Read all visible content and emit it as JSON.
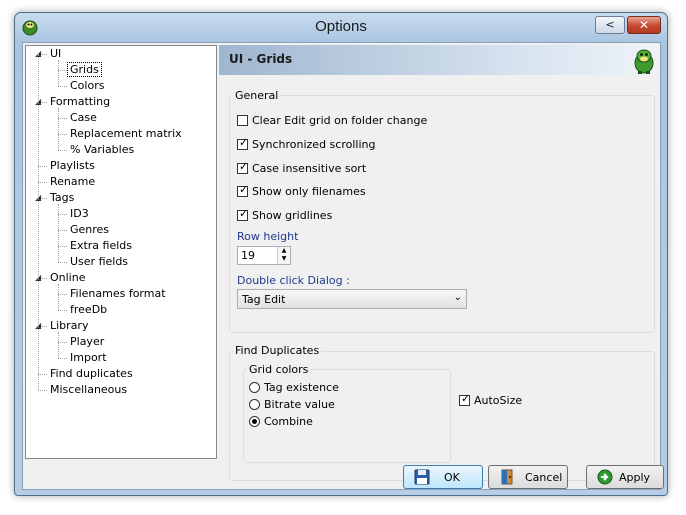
{
  "window": {
    "title": "Options",
    "minimize_glyph": "<",
    "close_glyph": "✕"
  },
  "tree": {
    "items": [
      {
        "label": "UI",
        "level": 0,
        "expanded": true
      },
      {
        "label": "Grids",
        "level": 1,
        "selected": true
      },
      {
        "label": "Colors",
        "level": 1
      },
      {
        "label": "Formatting",
        "level": 0,
        "expanded": true
      },
      {
        "label": "Case",
        "level": 1
      },
      {
        "label": "Replacement matrix",
        "level": 1
      },
      {
        "label": "% Variables",
        "level": 1
      },
      {
        "label": "Playlists",
        "level": 0
      },
      {
        "label": "Rename",
        "level": 0
      },
      {
        "label": "Tags",
        "level": 0,
        "expanded": true
      },
      {
        "label": "ID3",
        "level": 1
      },
      {
        "label": "Genres",
        "level": 1
      },
      {
        "label": "Extra fields",
        "level": 1
      },
      {
        "label": "User fields",
        "level": 1
      },
      {
        "label": "Online",
        "level": 0,
        "expanded": true
      },
      {
        "label": "Filenames format",
        "level": 1
      },
      {
        "label": "freeDb",
        "level": 1
      },
      {
        "label": "Library",
        "level": 0,
        "expanded": true
      },
      {
        "label": "Player",
        "level": 1
      },
      {
        "label": "Import",
        "level": 1
      },
      {
        "label": "Find duplicates",
        "level": 0
      },
      {
        "label": "Miscellaneous",
        "level": 0
      }
    ]
  },
  "header": {
    "title": "UI - Grids"
  },
  "general": {
    "legend": "General",
    "checkboxes": [
      {
        "label": "Clear Edit grid on folder change",
        "checked": false
      },
      {
        "label": "Synchronized scrolling",
        "checked": true
      },
      {
        "label": "Case insensitive sort",
        "checked": true
      },
      {
        "label": "Show only filenames",
        "checked": true
      },
      {
        "label": "Show gridlines",
        "checked": true
      }
    ],
    "row_height_label": "Row height",
    "row_height_value": "19",
    "dblclick_label": "Double click Dialog :",
    "dblclick_value": "Tag Edit"
  },
  "find_duplicates": {
    "legend": "Find Duplicates",
    "grid_colors_legend": "Grid colors",
    "radios": [
      {
        "label": "Tag existence",
        "checked": false
      },
      {
        "label": "Bitrate value",
        "checked": false
      },
      {
        "label": "Combine",
        "checked": true
      }
    ],
    "autosize": {
      "label": "AutoSize",
      "checked": true
    }
  },
  "buttons": {
    "ok": "OK",
    "cancel": "Cancel",
    "apply": "Apply"
  },
  "colors": {
    "accent_blue": "#1f3a8f",
    "close_red": "#c8472f",
    "title_gradient": "#a9c4e0"
  }
}
